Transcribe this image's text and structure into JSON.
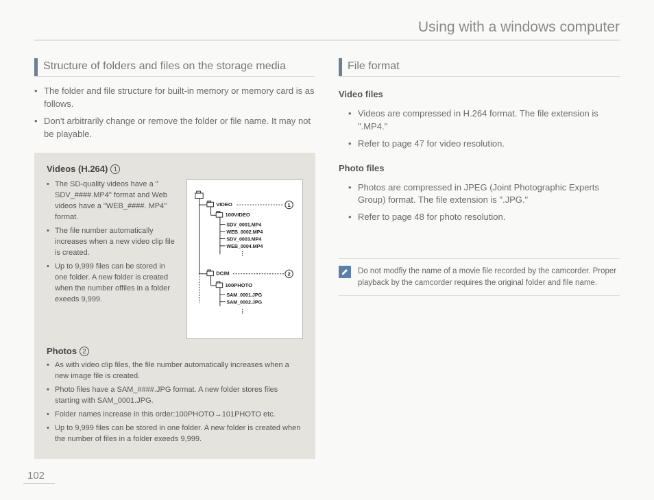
{
  "pageTitle": "Using with a windows computer",
  "pageNumber": "102",
  "left": {
    "sectionTitle": "Structure of folders and files on the storage media",
    "intro": [
      "The folder and file structure for built-in memory or memory card is as follows.",
      "Don't arbitrarily change or remove the folder or file name. It may not be playable."
    ],
    "box": {
      "videosHeading": "Videos (H.264)",
      "videosNum": "1",
      "videosItems": [
        "The SD-quality videos have a \" SDV_####.MP4\" format and Web videos have a \"WEB_####. MP4\" format.",
        "The file number automatically increases when a new video clip file is created.",
        "Up to 9,999 files can be stored in one folder. A new folder is created when the number offiles in a folder exeeds 9,999."
      ],
      "tree": {
        "video": "VIDEO",
        "videoFolder": "100VIDEO",
        "videoFiles": [
          "SDV_0001.MP4",
          "WEB_0002.MP4",
          "SDV_0003.MP4",
          "WEB_0004.MP4"
        ],
        "dcim": "DCIM",
        "photoFolder": "100PHOTO",
        "photoFiles": [
          "SAM_0001.JPG",
          "SAM_0002.JPG"
        ],
        "mark1": "1",
        "mark2": "2"
      },
      "photosHeading": "Photos",
      "photosNum": "2",
      "photosItems": [
        "As with video clip files, the file number automatically increases when a new image file is created.",
        "Photo files have a SAM_####.JPG format. A new folder stores files starting with SAM_0001.JPG.",
        "Folder names increase in this order:100PHOTO→101PHOTO etc.",
        "Up to 9,999 files can be stored in one folder. A new folder is created when the number of files in a folder exeeds 9,999."
      ]
    }
  },
  "right": {
    "sectionTitle": "File format",
    "videoHeading": "Video files",
    "videoItems": [
      "Videos are compressed in H.264 format. The file extension is \".MP4.\"",
      "Refer to page 47 for video resolution."
    ],
    "photoHeading": "Photo files",
    "photoItems": [
      "Photos are compressed in JPEG (Joint Photographic Experts Group) format. The file extension is \".JPG.\"",
      "Refer to page 48 for photo resolution."
    ],
    "note": "Do not modfiy the name of a movie file recorded by the camcorder. Proper playback by the camcorder requires the original folder and file name."
  }
}
